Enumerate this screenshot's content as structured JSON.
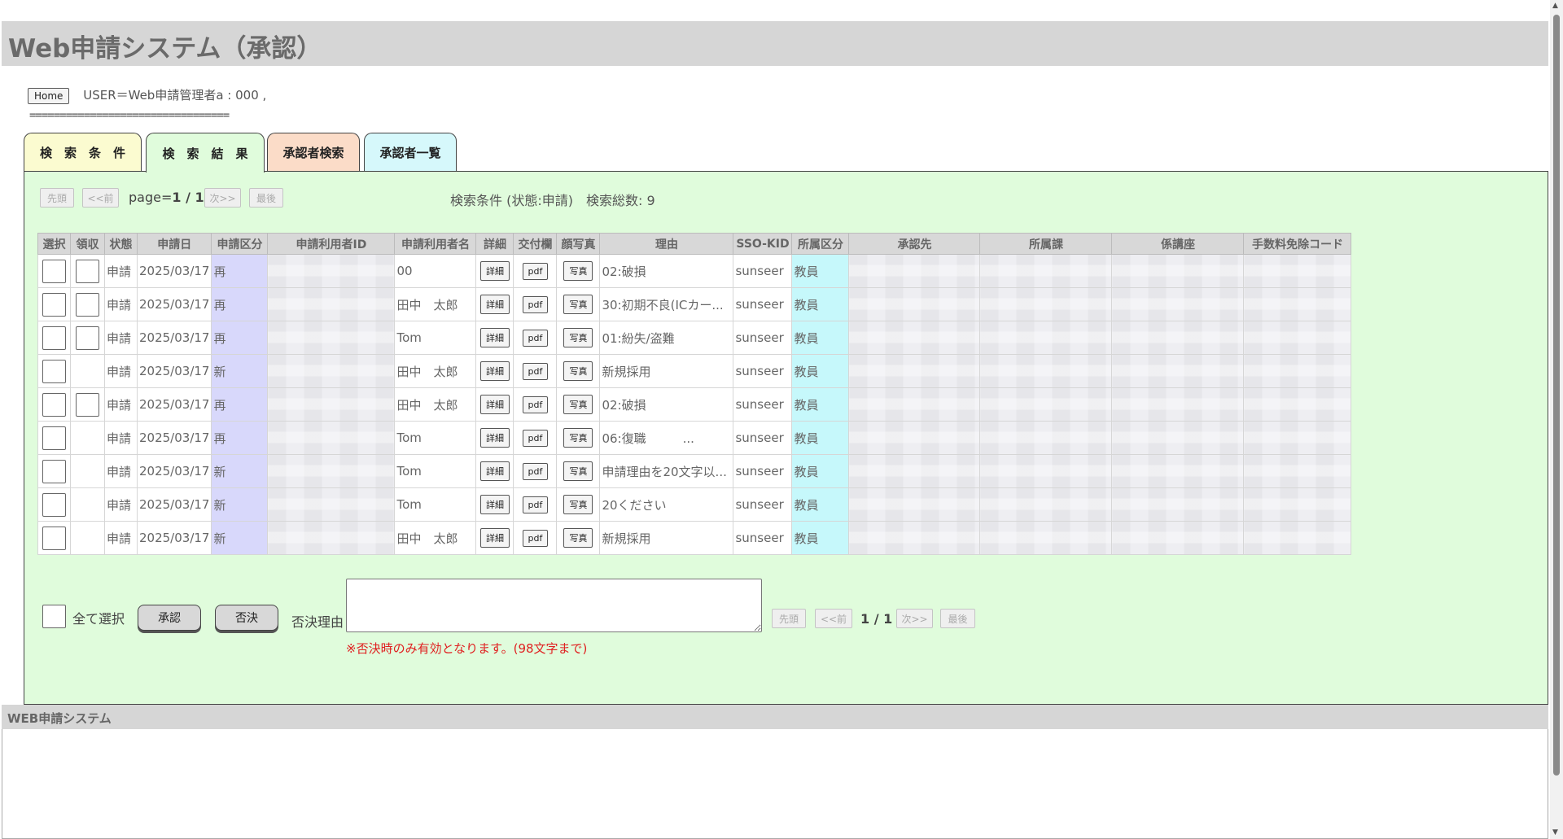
{
  "header": {
    "title": "Web申請システム（承認）"
  },
  "user_bar": {
    "home_label": "Home",
    "user_text": "USER＝Web申請管理者a : 000 ,",
    "separator": "================================="
  },
  "tabs": [
    {
      "label": "検　索　条　件",
      "color": "#fbfbd0"
    },
    {
      "label": "検　索　結　果",
      "color": "#e0fcdc"
    },
    {
      "label": "承認者検索",
      "color": "#fbdcc8"
    },
    {
      "label": "承認者一覧",
      "color": "#d6f8fb"
    }
  ],
  "pager_top": {
    "first": "先頭",
    "prev": "<<前",
    "page_label": "page=",
    "page_value": "1 / 1",
    "next": "次>>",
    "last": "最後"
  },
  "search_info": "検索条件 (状態:申請)　検索総数: 9",
  "table": {
    "headers": [
      "選択",
      "領収",
      "状態",
      "申請日",
      "申請区分",
      "申請利用者ID",
      "申請利用者名",
      "詳細",
      "交付欄",
      "顔写真",
      "理由",
      "SSO-KID",
      "所属区分",
      "承認先",
      "所属課",
      "係講座",
      "手数料免除コード"
    ],
    "detail_label": "詳細",
    "pdf_label": "pdf",
    "photo_label": "写真",
    "rows": [
      {
        "status": "申請",
        "date": "2025/03/17",
        "kubun": "再",
        "name": "00",
        "reason": "02:破損",
        "kid": "sunseer",
        "shozoku": "教員",
        "receipt": true
      },
      {
        "status": "申請",
        "date": "2025/03/17",
        "kubun": "再",
        "name": "田中　太郎",
        "reason": "30:初期不良(ICカー...",
        "kid": "sunseer",
        "shozoku": "教員",
        "receipt": true
      },
      {
        "status": "申請",
        "date": "2025/03/17",
        "kubun": "再",
        "name": "Tom",
        "reason": "01:紛失/盗難",
        "kid": "sunseer",
        "shozoku": "教員",
        "receipt": true
      },
      {
        "status": "申請",
        "date": "2025/03/17",
        "kubun": "新",
        "name": "田中　太郎",
        "reason": "新規採用",
        "kid": "sunseer",
        "shozoku": "教員",
        "receipt": false
      },
      {
        "status": "申請",
        "date": "2025/03/17",
        "kubun": "再",
        "name": "田中　太郎",
        "reason": "02:破損",
        "kid": "sunseer",
        "shozoku": "教員",
        "receipt": true
      },
      {
        "status": "申請",
        "date": "2025/03/17",
        "kubun": "再",
        "name": "Tom",
        "reason": "06:復職　　　...",
        "kid": "sunseer",
        "shozoku": "教員",
        "receipt": false
      },
      {
        "status": "申請",
        "date": "2025/03/17",
        "kubun": "新",
        "name": "Tom",
        "reason": "申請理由を20文字以...",
        "kid": "sunseer",
        "shozoku": "教員",
        "receipt": false
      },
      {
        "status": "申請",
        "date": "2025/03/17",
        "kubun": "新",
        "name": "Tom",
        "reason": "20ください",
        "kid": "sunseer",
        "shozoku": "教員",
        "receipt": false
      },
      {
        "status": "申請",
        "date": "2025/03/17",
        "kubun": "新",
        "name": "田中　太郎",
        "reason": "新規採用",
        "kid": "sunseer",
        "shozoku": "教員",
        "receipt": false
      }
    ]
  },
  "actions": {
    "select_all": "全て選択",
    "approve": "承認",
    "reject": "否決",
    "reason_label": "否決理由",
    "note": "※否決時のみ有効となります。(98文字まで)"
  },
  "pager_bottom": {
    "first": "先頭",
    "prev": "<<前",
    "page_value": "1 / 1",
    "next": "次>>",
    "last": "最後"
  },
  "footer": {
    "title": "WEB申請システム"
  },
  "colors": {
    "panel": "#e0fcdc",
    "kubun": "#d8d8fb",
    "shozoku": "#c6f8fb",
    "note": "#e02020"
  }
}
